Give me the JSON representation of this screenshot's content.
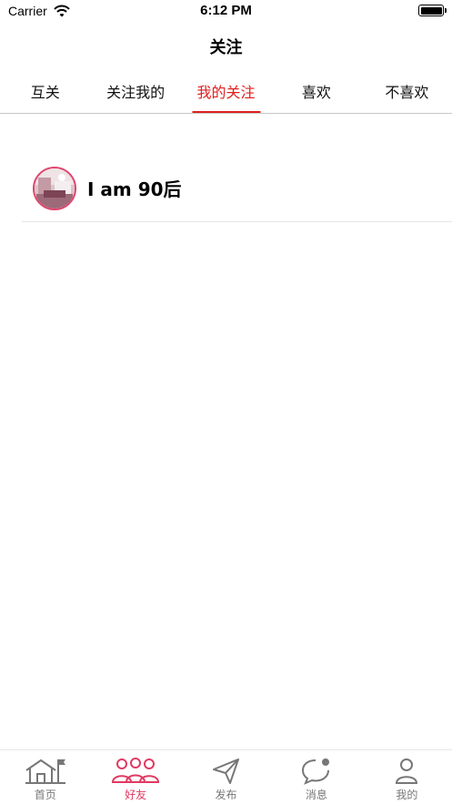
{
  "status_bar": {
    "carrier": "Carrier",
    "time": "6:12 PM"
  },
  "nav": {
    "title": "关注"
  },
  "tabs": [
    {
      "label": "互关",
      "active": false
    },
    {
      "label": "关注我的",
      "active": false
    },
    {
      "label": "我的关注",
      "active": true
    },
    {
      "label": "喜欢",
      "active": false
    },
    {
      "label": "不喜欢",
      "active": false
    }
  ],
  "list": [
    {
      "username": "I am 90后",
      "avatar_icon": "avatar-photo"
    }
  ],
  "tab_bar": {
    "items": [
      {
        "label": "首页",
        "icon": "home-icon"
      },
      {
        "label": "好友",
        "icon": "friends-icon",
        "active": true
      },
      {
        "label": "发布",
        "icon": "send-icon"
      },
      {
        "label": "消息",
        "icon": "message-icon"
      },
      {
        "label": "我的",
        "icon": "profile-icon"
      }
    ]
  },
  "colors": {
    "accent_red": "#e02020",
    "tab_bar_active": "#e03a64",
    "tab_bar_inactive": "#777777"
  }
}
